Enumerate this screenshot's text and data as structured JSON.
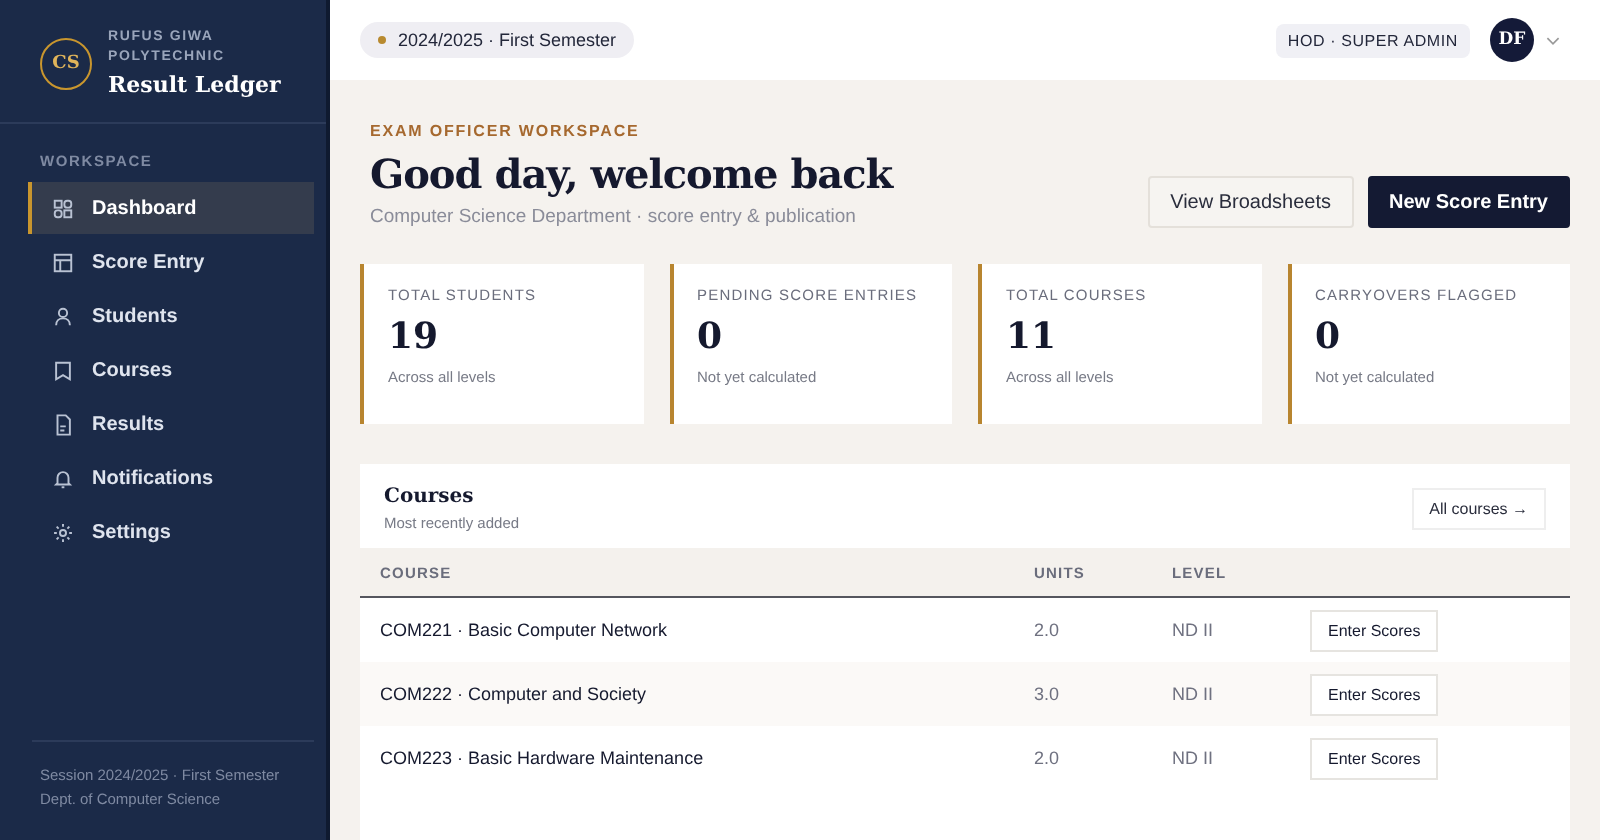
{
  "brand": {
    "logo": "CS",
    "institution_line_1": "RUFUS GIWA",
    "institution_line_2": "POLYTECHNIC",
    "app_name": "Result Ledger"
  },
  "sidebar": {
    "section_label": "WORKSPACE",
    "items": [
      {
        "label": "Dashboard",
        "selected": true
      },
      {
        "label": "Score Entry",
        "selected": false
      },
      {
        "label": "Students",
        "selected": false
      },
      {
        "label": "Courses",
        "selected": false
      },
      {
        "label": "Results",
        "selected": false
      },
      {
        "label": "Notifications",
        "selected": false
      },
      {
        "label": "Settings",
        "selected": false
      }
    ],
    "footer_line_1": "Session 2024/2025 · First Semester",
    "footer_line_2": "Dept. of Computer Science"
  },
  "topbar": {
    "session_chip": "2024/2025 ·  First Semester",
    "role_badge": "HOD · SUPER ADMIN",
    "avatar_initials": "DF"
  },
  "header": {
    "eyebrow": "EXAM OFFICER WORKSPACE",
    "title": "Good day, welcome back",
    "subtitle": "Computer Science Department · score entry & publication",
    "buttons": [
      {
        "label": "View Broadsheets",
        "kind": "secondary"
      },
      {
        "label": "New Score Entry",
        "kind": "primary"
      }
    ]
  },
  "stats": [
    {
      "label": "TOTAL STUDENTS",
      "value": "19",
      "note": "Across all levels"
    },
    {
      "label": "PENDING SCORE ENTRIES",
      "value": "0",
      "note": "Not yet calculated"
    },
    {
      "label": "TOTAL COURSES",
      "value": "11",
      "note": "Across all levels"
    },
    {
      "label": "CARRYOVERS FLAGGED",
      "value": "0",
      "note": "Not yet calculated"
    }
  ],
  "courses_panel": {
    "title": "Courses",
    "subtitle": "Most recently added",
    "link": "All courses →",
    "columns": [
      "COURSE",
      "UNITS",
      "LEVEL"
    ],
    "rows": [
      {
        "course": "COM221 · Basic Computer Network",
        "units": "2.0",
        "level": "ND II",
        "action": "Enter Scores"
      },
      {
        "course": "COM222 · Computer and Society",
        "units": "3.0",
        "level": "ND II",
        "action": "Enter Scores"
      },
      {
        "course": "COM223 · Basic Hardware Maintenance",
        "units": "2.0",
        "level": "ND II",
        "action": "Enter Scores"
      }
    ]
  }
}
